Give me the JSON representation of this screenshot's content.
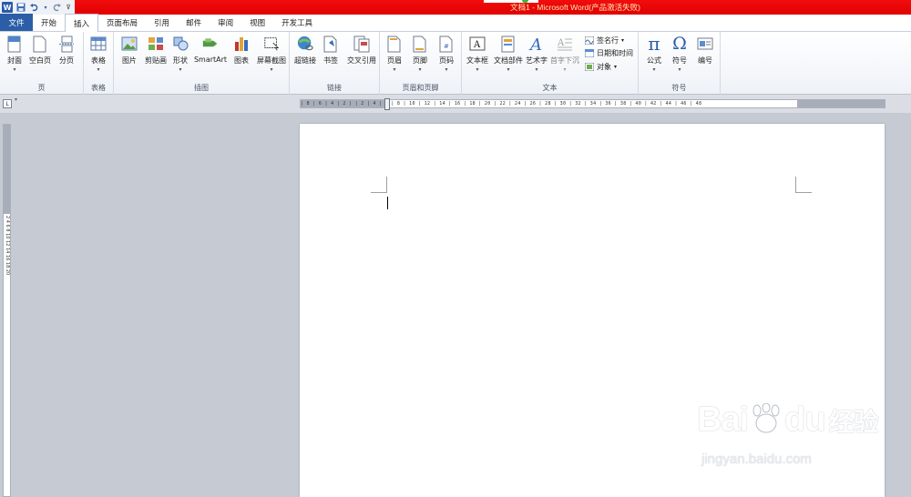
{
  "window": {
    "title": "文档1 - Microsoft Word(产品激活失败)",
    "qat": {
      "logo": "W"
    }
  },
  "tabs": [
    {
      "label": "文件"
    },
    {
      "label": "开始"
    },
    {
      "label": "插入"
    },
    {
      "label": "页面布局"
    },
    {
      "label": "引用"
    },
    {
      "label": "邮件"
    },
    {
      "label": "审阅"
    },
    {
      "label": "视图"
    },
    {
      "label": "开发工具"
    }
  ],
  "active_tab": "插入",
  "ribbon": {
    "groups": {
      "pages": {
        "label": "页",
        "buttons": [
          "封面",
          "空白页",
          "分页"
        ]
      },
      "tables": {
        "label": "表格",
        "buttons": [
          "表格"
        ]
      },
      "illustrations": {
        "label": "插图",
        "buttons": [
          "图片",
          "剪贴画",
          "形状",
          "SmartArt",
          "图表",
          "屏幕截图"
        ]
      },
      "links": {
        "label": "链接",
        "buttons": [
          "超链接",
          "书签",
          "交叉引用"
        ]
      },
      "header_footer": {
        "label": "页眉和页脚",
        "buttons": [
          "页眉",
          "页脚",
          "页码"
        ]
      },
      "text": {
        "label": "文本",
        "buttons": [
          "文本框",
          "文档部件",
          "艺术字",
          "首字下沉"
        ],
        "small": [
          "签名行",
          "日期和时间",
          "对象"
        ]
      },
      "symbols": {
        "label": "符号",
        "buttons": [
          "公式",
          "符号",
          "编号"
        ]
      }
    }
  },
  "ruler": {
    "h_numbers": "| 8 | 6 | 4 | 2 |   | 2 | 4 | 6 | 8 | 10 | 12 | 14 | 16 | 18 | 20 | 22 | 24 | 26 | 28 | 30 | 32 | 34 | 36 | 38 | 40 | 42 | 44 | 46 | 48",
    "v_numbers": "2 4 6 8 10 12 14 16 18 20",
    "corner": "L"
  },
  "watermark": {
    "brand": "Bai",
    "brand2": "du",
    "cn": "经验",
    "url": "jingyan.baidu.com"
  },
  "colors": {
    "title_bar": "#e60000",
    "file_tab": "#2b5ea7",
    "workspace": "#c6cad3"
  }
}
